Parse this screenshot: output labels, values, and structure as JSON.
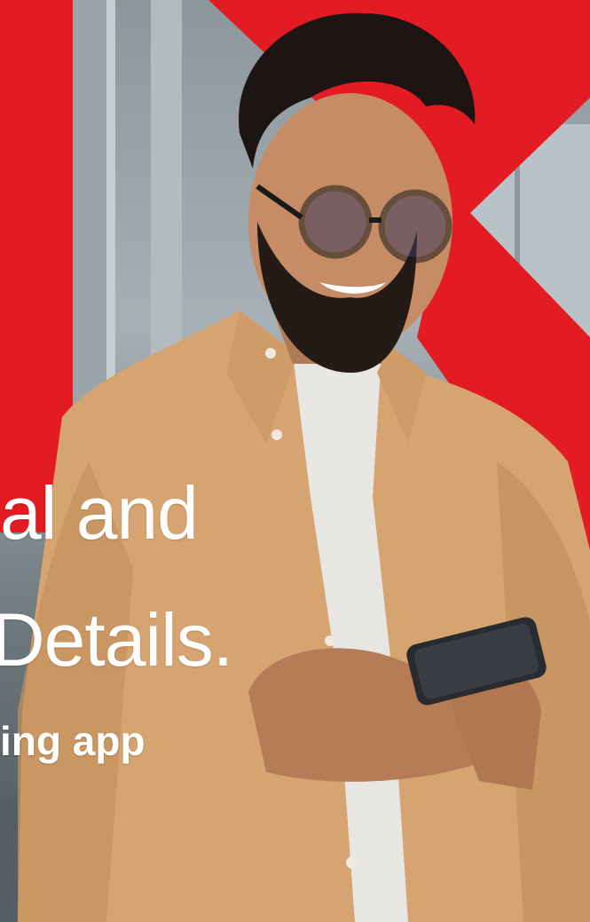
{
  "hero": {
    "headline_line1": "al and",
    "headline_line2": "Details.",
    "subheadline": "ing app"
  },
  "colors": {
    "brand_red": "#e31b23",
    "text": "#ffffff",
    "shirt": "#d6a470",
    "tshirt": "#e8e6e2",
    "phone": "#2a2b30"
  },
  "image": {
    "subject": "smiling-man-with-glasses-using-smartphone"
  }
}
